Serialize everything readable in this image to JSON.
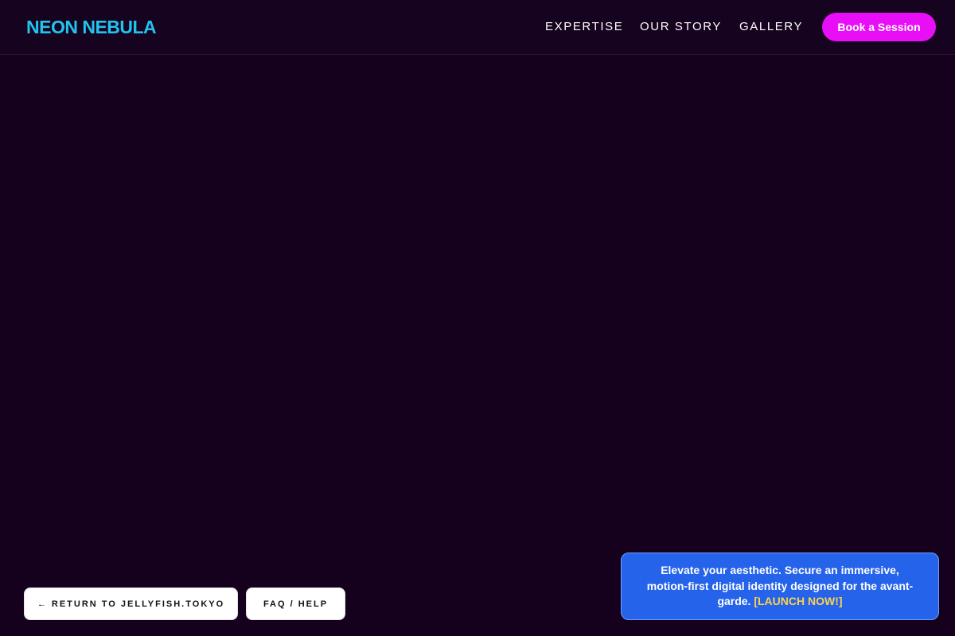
{
  "header": {
    "logo": "NEON NEBULA",
    "nav": [
      {
        "label": "EXPERTISE"
      },
      {
        "label": "OUR STORY"
      },
      {
        "label": "GALLERY"
      }
    ],
    "cta_label": "Book a Session"
  },
  "footer_buttons": {
    "return_label": "← RETURN TO JELLYFISH.TOKYO",
    "faq_label": "FAQ / HELP"
  },
  "promo": {
    "text": "Elevate your aesthetic. Secure an immersive, motion-first digital identity designed for the avant-garde.",
    "link_label": "[LAUNCH NOW!]"
  },
  "colors": {
    "background": "#15001e",
    "logo": "#22c3ee",
    "cta": "#e80ef5",
    "promo": "#2563eb",
    "promo_link": "#fcd34d"
  }
}
